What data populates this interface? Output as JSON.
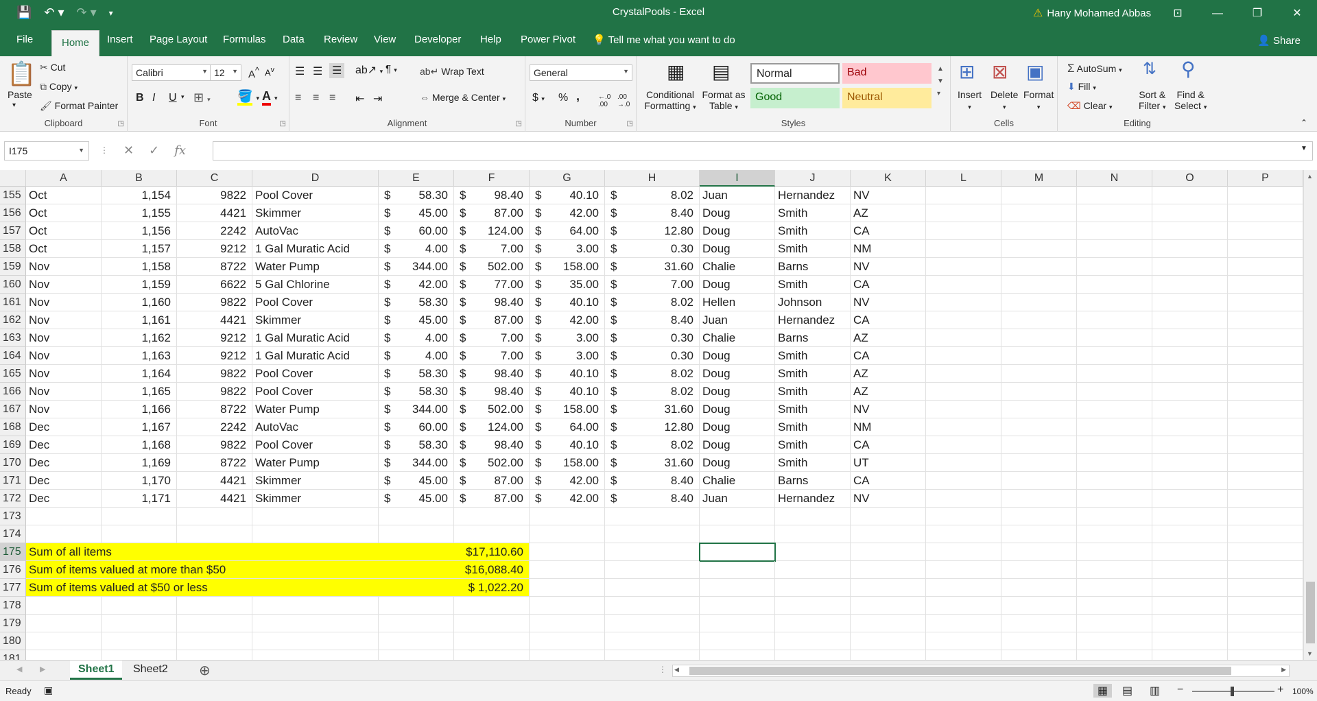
{
  "window": {
    "title": "CrystalPools - Excel",
    "user": "Hany Mohamed Abbas"
  },
  "tabs": [
    "File",
    "Home",
    "Insert",
    "Page Layout",
    "Formulas",
    "Data",
    "Review",
    "View",
    "Developer",
    "Help",
    "Power Pivot"
  ],
  "active_tab": "Home",
  "tell_me": "Tell me what you want to do",
  "share": "Share",
  "ribbon": {
    "clipboard": {
      "label": "Clipboard",
      "paste": "Paste",
      "cut": "Cut",
      "copy": "Copy",
      "format_painter": "Format Painter"
    },
    "font": {
      "label": "Font",
      "font_name": "Calibri",
      "font_size": "12",
      "bold": "B",
      "italic": "I",
      "underline": "U"
    },
    "alignment": {
      "label": "Alignment",
      "wrap_text": "Wrap Text",
      "merge_center": "Merge & Center"
    },
    "number": {
      "label": "Number",
      "format": "General",
      "currency": "$",
      "percent": "%",
      "comma": ","
    },
    "styles": {
      "label": "Styles",
      "conditional": "Conditional",
      "formatting": "Formatting",
      "format_as": "Format as",
      "table": "Table",
      "normal": "Normal",
      "bad": "Bad",
      "good": "Good",
      "neutral": "Neutral"
    },
    "cells": {
      "label": "Cells",
      "insert": "Insert",
      "delete": "Delete",
      "format": "Format"
    },
    "editing": {
      "label": "Editing",
      "autosum": "AutoSum",
      "fill": "Fill",
      "clear": "Clear",
      "sort": "Sort &",
      "filter": "Filter",
      "find": "Find &",
      "select": "Select"
    }
  },
  "formula_bar": {
    "name_box": "I175",
    "fx": "fx",
    "content": ""
  },
  "columns": [
    "A",
    "B",
    "C",
    "D",
    "E",
    "F",
    "G",
    "H",
    "I",
    "J",
    "K",
    "L",
    "M",
    "N",
    "O",
    "P"
  ],
  "selected_column": "I",
  "rows": [
    {
      "n": "155",
      "a": "Oct",
      "b": "1,154",
      "c": "9822",
      "d": "Pool Cover",
      "e": "58.30",
      "f": "98.40",
      "g": "40.10",
      "h": "8.02",
      "i": "Juan",
      "j": "Hernandez",
      "k": "NV"
    },
    {
      "n": "156",
      "a": "Oct",
      "b": "1,155",
      "c": "4421",
      "d": "Skimmer",
      "e": "45.00",
      "f": "87.00",
      "g": "42.00",
      "h": "8.40",
      "i": "Doug",
      "j": "Smith",
      "k": "AZ"
    },
    {
      "n": "157",
      "a": "Oct",
      "b": "1,156",
      "c": "2242",
      "d": "AutoVac",
      "e": "60.00",
      "f": "124.00",
      "g": "64.00",
      "h": "12.80",
      "i": "Doug",
      "j": "Smith",
      "k": "CA"
    },
    {
      "n": "158",
      "a": "Oct",
      "b": "1,157",
      "c": "9212",
      "d": "1 Gal Muratic Acid",
      "e": "4.00",
      "f": "7.00",
      "g": "3.00",
      "h": "0.30",
      "i": "Doug",
      "j": "Smith",
      "k": "NM"
    },
    {
      "n": "159",
      "a": "Nov",
      "b": "1,158",
      "c": "8722",
      "d": "Water Pump",
      "e": "344.00",
      "f": "502.00",
      "g": "158.00",
      "h": "31.60",
      "i": "Chalie",
      "j": "Barns",
      "k": "NV"
    },
    {
      "n": "160",
      "a": "Nov",
      "b": "1,159",
      "c": "6622",
      "d": "5 Gal Chlorine",
      "e": "42.00",
      "f": "77.00",
      "g": "35.00",
      "h": "7.00",
      "i": "Doug",
      "j": "Smith",
      "k": "CA"
    },
    {
      "n": "161",
      "a": "Nov",
      "b": "1,160",
      "c": "9822",
      "d": "Pool Cover",
      "e": "58.30",
      "f": "98.40",
      "g": "40.10",
      "h": "8.02",
      "i": "Hellen",
      "j": "Johnson",
      "k": "NV"
    },
    {
      "n": "162",
      "a": "Nov",
      "b": "1,161",
      "c": "4421",
      "d": "Skimmer",
      "e": "45.00",
      "f": "87.00",
      "g": "42.00",
      "h": "8.40",
      "i": "Juan",
      "j": "Hernandez",
      "k": "CA"
    },
    {
      "n": "163",
      "a": "Nov",
      "b": "1,162",
      "c": "9212",
      "d": "1 Gal Muratic Acid",
      "e": "4.00",
      "f": "7.00",
      "g": "3.00",
      "h": "0.30",
      "i": "Chalie",
      "j": "Barns",
      "k": "AZ"
    },
    {
      "n": "164",
      "a": "Nov",
      "b": "1,163",
      "c": "9212",
      "d": "1 Gal Muratic Acid",
      "e": "4.00",
      "f": "7.00",
      "g": "3.00",
      "h": "0.30",
      "i": "Doug",
      "j": "Smith",
      "k": "CA"
    },
    {
      "n": "165",
      "a": "Nov",
      "b": "1,164",
      "c": "9822",
      "d": "Pool Cover",
      "e": "58.30",
      "f": "98.40",
      "g": "40.10",
      "h": "8.02",
      "i": "Doug",
      "j": "Smith",
      "k": "AZ"
    },
    {
      "n": "166",
      "a": "Nov",
      "b": "1,165",
      "c": "9822",
      "d": "Pool Cover",
      "e": "58.30",
      "f": "98.40",
      "g": "40.10",
      "h": "8.02",
      "i": "Doug",
      "j": "Smith",
      "k": "AZ"
    },
    {
      "n": "167",
      "a": "Nov",
      "b": "1,166",
      "c": "8722",
      "d": "Water Pump",
      "e": "344.00",
      "f": "502.00",
      "g": "158.00",
      "h": "31.60",
      "i": "Doug",
      "j": "Smith",
      "k": "NV"
    },
    {
      "n": "168",
      "a": "Dec",
      "b": "1,167",
      "c": "2242",
      "d": "AutoVac",
      "e": "60.00",
      "f": "124.00",
      "g": "64.00",
      "h": "12.80",
      "i": "Doug",
      "j": "Smith",
      "k": "NM"
    },
    {
      "n": "169",
      "a": "Dec",
      "b": "1,168",
      "c": "9822",
      "d": "Pool Cover",
      "e": "58.30",
      "f": "98.40",
      "g": "40.10",
      "h": "8.02",
      "i": "Doug",
      "j": "Smith",
      "k": "CA"
    },
    {
      "n": "170",
      "a": "Dec",
      "b": "1,169",
      "c": "8722",
      "d": "Water Pump",
      "e": "344.00",
      "f": "502.00",
      "g": "158.00",
      "h": "31.60",
      "i": "Doug",
      "j": "Smith",
      "k": "UT"
    },
    {
      "n": "171",
      "a": "Dec",
      "b": "1,170",
      "c": "4421",
      "d": "Skimmer",
      "e": "45.00",
      "f": "87.00",
      "g": "42.00",
      "h": "8.40",
      "i": "Chalie",
      "j": "Barns",
      "k": "CA"
    },
    {
      "n": "172",
      "a": "Dec",
      "b": "1,171",
      "c": "4421",
      "d": "Skimmer",
      "e": "45.00",
      "f": "87.00",
      "g": "42.00",
      "h": "8.40",
      "i": "Juan",
      "j": "Hernandez",
      "k": "NV"
    }
  ],
  "empty_rows_before": [
    "173",
    "174"
  ],
  "summary": [
    {
      "n": "175",
      "label": "Sum of all items",
      "value": "$17,110.60"
    },
    {
      "n": "176",
      "label": "Sum of items valued at more than $50",
      "value": "$16,088.40"
    },
    {
      "n": "177",
      "label": "Sum of items valued at $50 or less",
      "value": "$  1,022.20"
    }
  ],
  "empty_rows_after": [
    "178",
    "179",
    "180",
    "181"
  ],
  "sheets": [
    "Sheet1",
    "Sheet2"
  ],
  "active_sheet": "Sheet1",
  "status": {
    "ready": "Ready",
    "zoom": "100%"
  }
}
